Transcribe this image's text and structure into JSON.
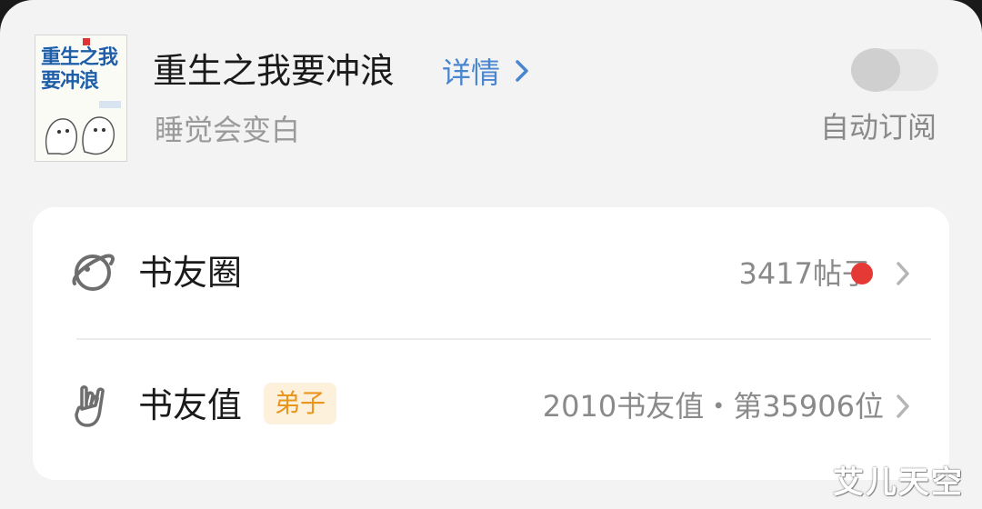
{
  "book": {
    "title": "重生之我要冲浪",
    "detail_label": "详情",
    "author": "睡觉会变白",
    "cover_title": "重生之我要冲浪",
    "cover_icon": "book-cover"
  },
  "auto_subscribe": {
    "label": "自动订阅",
    "enabled": false
  },
  "rows": [
    {
      "title": "书友圈",
      "value": "3417帖子",
      "icon": "planet-icon",
      "has_unread_dot": true
    },
    {
      "title": "书友值",
      "badge": "弟子",
      "value": "2010书友值・第35906位",
      "icon": "hand-gesture-icon"
    }
  ],
  "watermark": "艾儿天空",
  "colors": {
    "accent": "#4a86d0",
    "badge_text": "#e8961e",
    "badge_bg": "#fdf1dc",
    "unread_dot": "#e53935"
  }
}
